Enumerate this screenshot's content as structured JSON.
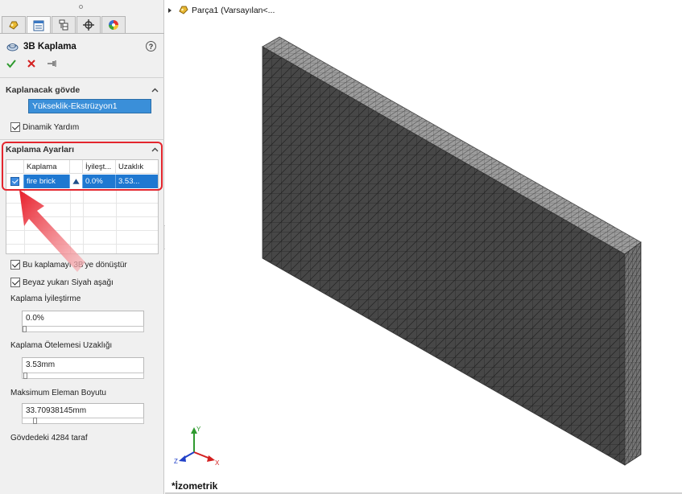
{
  "panel": {
    "tabs": [
      {
        "icon": "feature-manager-icon",
        "active": false
      },
      {
        "icon": "property-manager-icon",
        "active": true
      },
      {
        "icon": "configuration-manager-icon",
        "active": false
      },
      {
        "icon": "dimxpert-icon",
        "active": false
      },
      {
        "icon": "display-manager-icon",
        "active": false
      }
    ],
    "title": "3B Kaplama",
    "help_label": "?",
    "section_body": {
      "heading": "Kaplanacak gövde",
      "selected_body": "Yükseklik-Ekstrüzyon1",
      "dynamic_help_label": "Dinamik Yardım"
    },
    "section_settings": {
      "heading": "Kaplama Ayarları",
      "columns": [
        "Kaplama",
        "İyileşt...",
        "Uzaklık"
      ],
      "rows": [
        {
          "checked": true,
          "name": "fire brick",
          "refinement": "0.0%",
          "distance": "3.53..."
        }
      ]
    },
    "options": {
      "convert_label": "Bu kaplamayı 3B'ye dönüştür",
      "white_up_label": "Beyaz yukarı Siyah aşağı",
      "refinement_label": "Kaplama İyileştirme",
      "refinement_value": "0.0%",
      "refinement_level": 0.0,
      "offset_label": "Kaplama Ötelemesi Uzaklığı",
      "offset_value": "3.53mm",
      "offset_level": 0.01,
      "max_element_label": "Maksimum Eleman Boyutu",
      "max_element_value": "33.70938145mm",
      "max_element_level": 0.09,
      "face_count": "Gövdedeki 4284 taraf"
    }
  },
  "viewport": {
    "tree_label": "Parça1  (Varsayılan<...",
    "view_name": "*İzometrik",
    "triad": {
      "x": "X",
      "y": "Y",
      "z": "Z"
    }
  },
  "colors": {
    "selection_blue": "#1f78d1",
    "highlight_red": "#e3262e",
    "mesh_front": "#4a4a4a",
    "mesh_top": "#9a9a9a",
    "mesh_side": "#6f6f6f"
  }
}
